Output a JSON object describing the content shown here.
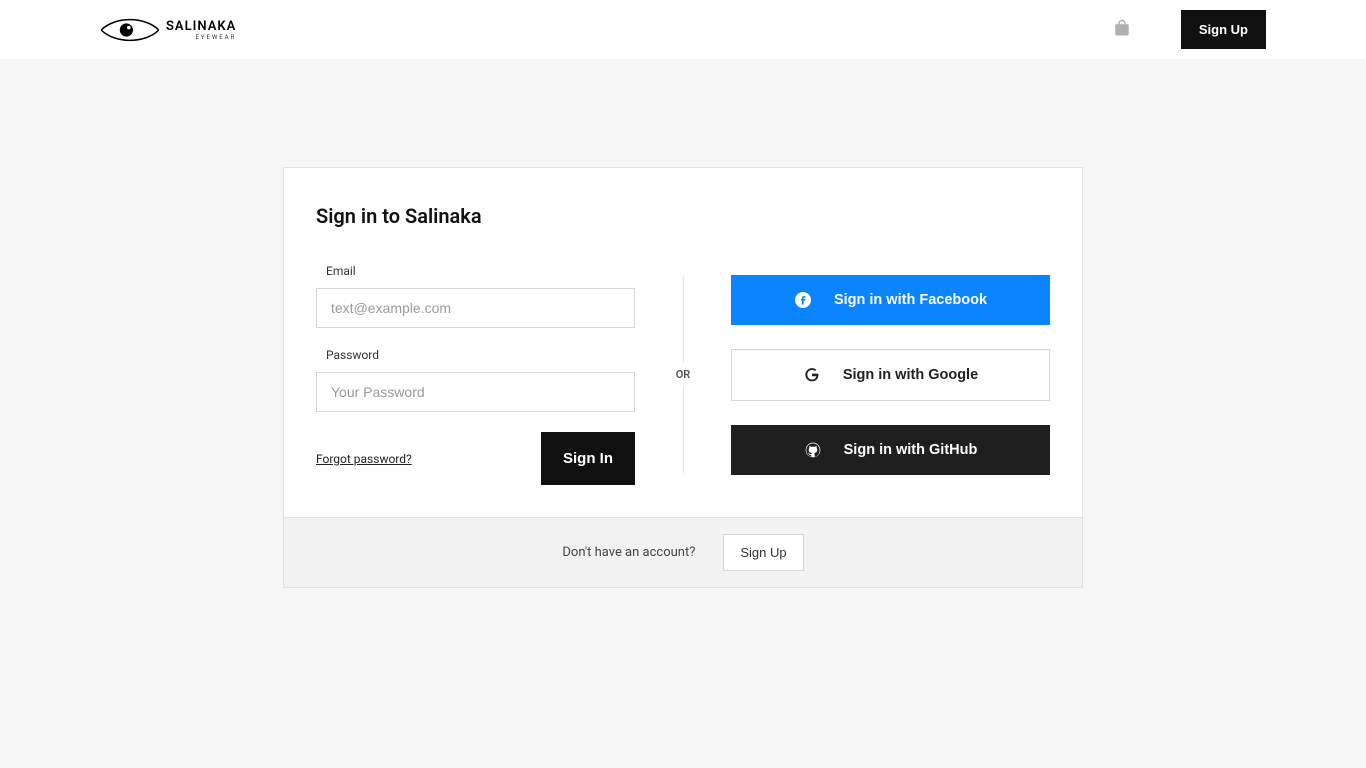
{
  "brand": {
    "name": "SALINAKA",
    "subtitle": "EYEWEAR"
  },
  "header": {
    "signup_label": "Sign Up"
  },
  "form": {
    "title": "Sign in to Salinaka",
    "email_label": "Email",
    "email_placeholder": "text@example.com",
    "password_label": "Password",
    "password_placeholder": "Your Password",
    "forgot_label": "Forgot password?",
    "signin_label": "Sign In",
    "divider_label": "OR"
  },
  "social": {
    "facebook_label": "Sign in with Facebook",
    "google_label": "Sign in with Google",
    "github_label": "Sign in with GitHub"
  },
  "footer": {
    "prompt": "Don't have an account?",
    "signup_label": "Sign Up"
  }
}
